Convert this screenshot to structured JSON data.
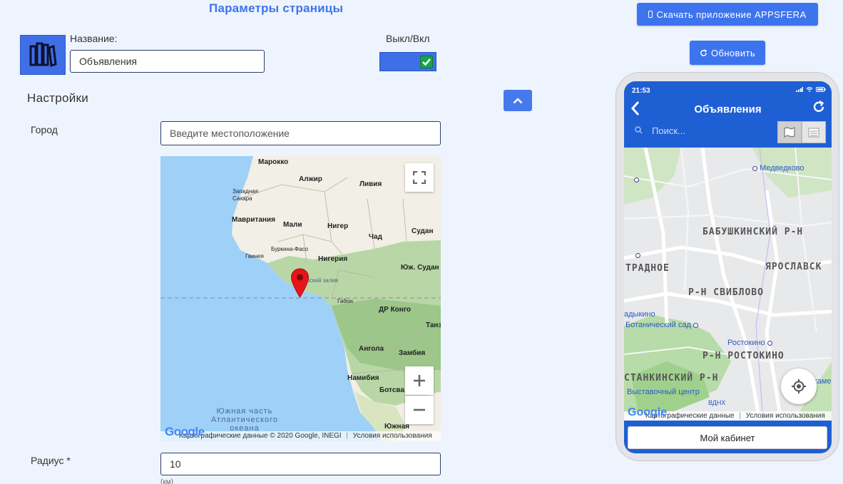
{
  "page": {
    "title": "Параметры страницы"
  },
  "form": {
    "name_label": "Название:",
    "name_value": "Объявления",
    "toggle_label": "Выкл/Вкл",
    "toggle_on": true,
    "settings_heading": "Настройки",
    "city_label": "Город",
    "city_placeholder": "Введите местоположение",
    "radius_label": "Радиус *",
    "radius_value": "10",
    "radius_hint": "(км)"
  },
  "map": {
    "labels": {
      "morocco": "Марокко",
      "algeria": "Алжир",
      "libya": "Ливия",
      "western_sahara": "Западная Сахара",
      "mauritania": "Мавритания",
      "mali": "Мали",
      "niger": "Нигер",
      "chad": "Чад",
      "sudan": "Судан",
      "burkina": "Буркина-Фасо",
      "guinea": "Гвинея",
      "nigeria": "Нигерия",
      "south_sudan": "Юж. Судан",
      "gulf": "ейский залив",
      "gabon": "Габон",
      "drc": "ДР Конго",
      "tanzania": "Танз",
      "angola": "Ангола",
      "zambia": "Замбия",
      "namibia": "Намибия",
      "botswana": "Ботсва",
      "south_africa": "Южная",
      "ocean": "Южная часть Атлантического океана"
    },
    "footer": "Картографические данные © 2020 Google, INEGI",
    "terms": "Условия использования",
    "brand": "Google"
  },
  "actions": {
    "download_label": "Скачать приложение APPSFERA",
    "refresh_label": "Обновить"
  },
  "phone": {
    "time": "21:53",
    "title": "Объявления",
    "search_placeholder": "Поиск...",
    "map_labels": {
      "medvedkovo": "Медведково",
      "babushkinsky": "БАБУШКИНСКИЙ Р-Н",
      "otradnoe": "ТРАДНОЕ",
      "yaroslavsky": "ЯРОСЛАВСК",
      "sviblovo": "Р-Н СВИБЛОВО",
      "vladykino": "адыкино",
      "botanical": "Ботанический сад",
      "rostokino_st": "Ростокино",
      "rostokino": "Р-Н РОСТОКИНО",
      "ostankinsky": "СТАНКИНСКИЙ Р-Н",
      "exhibition": "Выставочный центр",
      "belokamenn": "Белокаменна",
      "vdnh": "ВДНХ"
    },
    "map_footer": "Картографические данные",
    "map_terms": "Условия использования",
    "map_brand": "Google",
    "cabinet_label": "Мой кабинет"
  },
  "colors": {
    "accent": "#3d74ed",
    "title": "#3d74e8",
    "phone_blue": "#1f5fd4",
    "toggle_check": "#16a34a"
  }
}
